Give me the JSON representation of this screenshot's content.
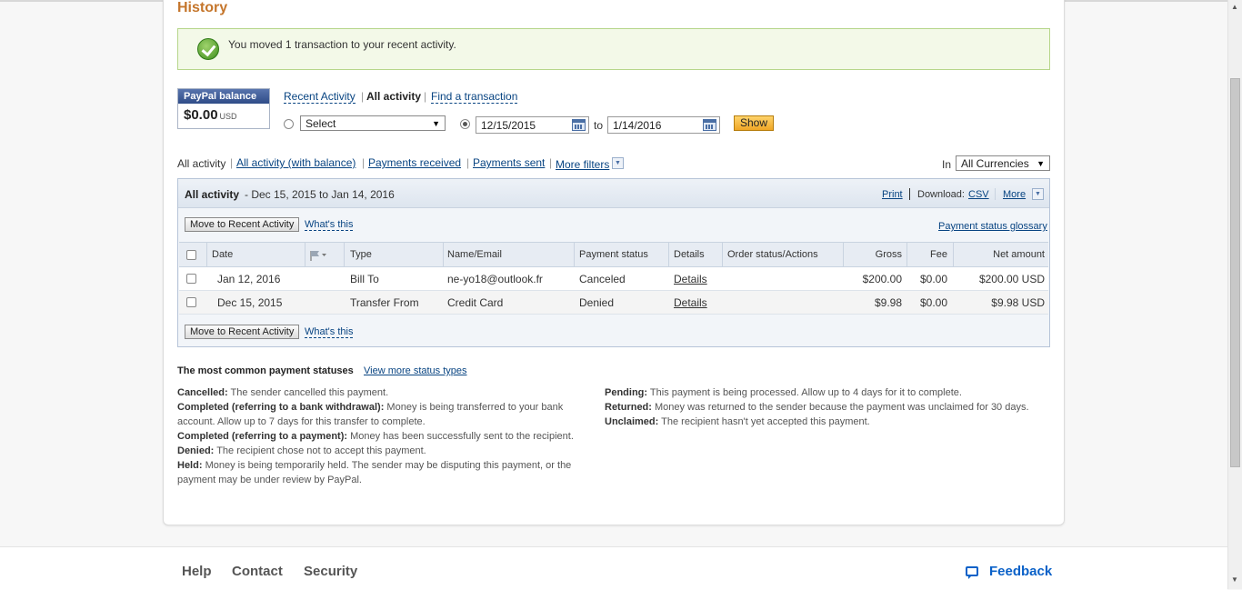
{
  "page": {
    "title": "History"
  },
  "notice": {
    "text": "You moved 1 transaction to your recent activity."
  },
  "balance": {
    "label": "PayPal balance",
    "amount": "$0.00",
    "currency": "USD"
  },
  "activity_tabs": {
    "recent": "Recent Activity",
    "all": "All activity",
    "find": "Find a transaction"
  },
  "date_filter": {
    "select_value": "Select",
    "from": "12/15/2015",
    "to_label": "to",
    "to": "1/14/2016",
    "show_label": "Show"
  },
  "filters": {
    "items": [
      "All activity",
      "All activity (with balance)",
      "Payments received",
      "Payments sent"
    ],
    "more": "More filters",
    "in_label": "In",
    "currency": "All Currencies"
  },
  "panel": {
    "title": "All activity",
    "range": "- Dec 15, 2015 to Jan 14, 2016",
    "print": "Print",
    "download_label": "Download:",
    "csv": "CSV",
    "more": "More",
    "move_button": "Move to Recent Activity",
    "whats_this": "What's this",
    "glossary": "Payment status glossary"
  },
  "table": {
    "columns": [
      "Date",
      "Type",
      "Name/Email",
      "Payment status",
      "Details",
      "Order status/Actions",
      "Gross",
      "Fee",
      "Net amount"
    ],
    "rows": [
      {
        "date": "Jan 12, 2016",
        "type": "Bill To",
        "name": "ne-yo18@outlook.fr",
        "status": "Canceled",
        "details": "Details",
        "order": "",
        "gross": "$200.00",
        "fee": "$0.00",
        "net": "$200.00 USD"
      },
      {
        "date": "Dec 15, 2015",
        "type": "Transfer From",
        "name": "Credit Card",
        "status": "Denied",
        "details": "Details",
        "order": "",
        "gross": "$9.98",
        "fee": "$0.00",
        "net": "$9.98 USD"
      }
    ]
  },
  "statuses": {
    "heading": "The most common payment statuses",
    "view_more": "View more status types",
    "left": [
      {
        "term": "Cancelled:",
        "desc": "The sender cancelled this payment."
      },
      {
        "term": "Completed (referring to a bank withdrawal):",
        "desc": "Money is being transferred to your bank account. Allow up to 7 days for this transfer to complete."
      },
      {
        "term": "Completed (referring to a payment):",
        "desc": "Money has been successfully sent to the recipient."
      },
      {
        "term": "Denied:",
        "desc": "The recipient chose not to accept this payment."
      },
      {
        "term": "Held:",
        "desc": "Money is being temporarily held. The sender may be disputing this payment, or the payment may be under review by PayPal."
      }
    ],
    "right": [
      {
        "term": "Pending:",
        "desc": "This payment is being processed. Allow up to 4 days for it to complete."
      },
      {
        "term": "Returned:",
        "desc": "Money was returned to the sender because the payment was unclaimed for 30 days."
      },
      {
        "term": "Unclaimed:",
        "desc": "The recipient hasn't yet accepted this payment."
      }
    ]
  },
  "footer": {
    "help": "Help",
    "contact": "Contact",
    "security": "Security",
    "feedback": "Feedback"
  }
}
